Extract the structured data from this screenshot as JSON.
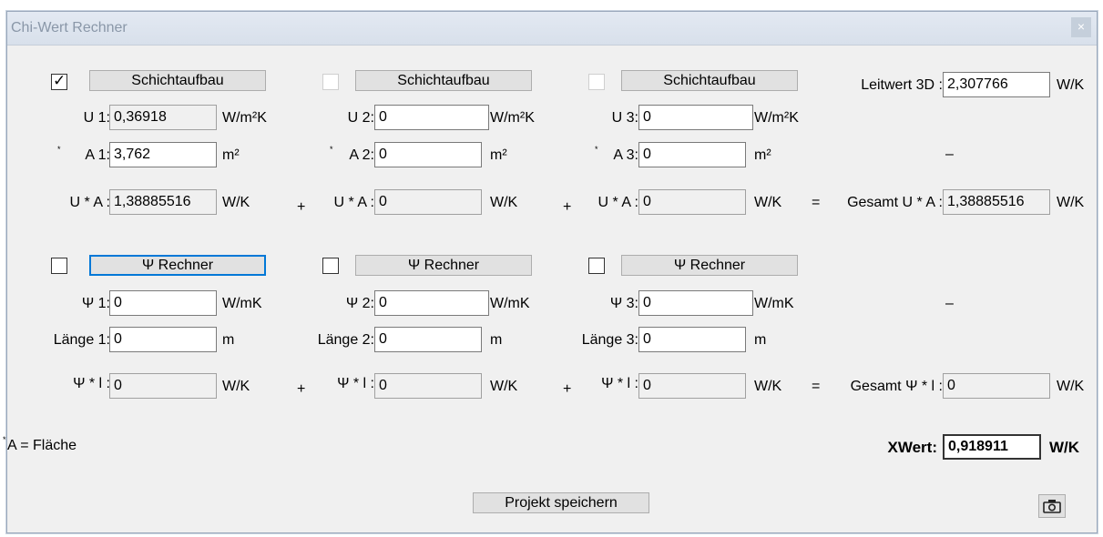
{
  "window": {
    "title": "Chi-Wert Rechner",
    "close_glyph": "×"
  },
  "layers": [
    {
      "checked": true,
      "button": "Schichtaufbau",
      "u_label": "U 1:",
      "u_value": "0,36918",
      "u_unit": "W/m²K",
      "a_label": "A 1:",
      "a_value": "3,762",
      "a_unit": "m²",
      "ua_label": "U * A :",
      "ua_value": "1,38885516",
      "ua_unit": "W/K"
    },
    {
      "checked": false,
      "button": "Schichtaufbau",
      "u_label": "U 2:",
      "u_value": "0",
      "u_unit": "W/m²K",
      "a_label": "A 2:",
      "a_value": "0",
      "a_unit": "m²",
      "ua_label": "U * A :",
      "ua_value": "0",
      "ua_unit": "W/K"
    },
    {
      "checked": false,
      "button": "Schichtaufbau",
      "u_label": "U 3:",
      "u_value": "0",
      "u_unit": "W/m²K",
      "a_label": "A 3:",
      "a_value": "0",
      "a_unit": "m²",
      "ua_label": "U * A :",
      "ua_value": "0",
      "ua_unit": "W/K"
    }
  ],
  "psi": [
    {
      "checked": false,
      "button": "Ψ Rechner",
      "psi_label": "Ψ 1:",
      "psi_value": "0",
      "psi_unit": "W/mK",
      "len_label": "Länge 1:",
      "len_value": "0",
      "len_unit": "m",
      "pl_label": "Ψ * l :",
      "pl_value": "0",
      "pl_unit": "W/K"
    },
    {
      "checked": false,
      "button": "Ψ Rechner",
      "psi_label": "Ψ 2:",
      "psi_value": "0",
      "psi_unit": "W/mK",
      "len_label": "Länge 2:",
      "len_value": "0",
      "len_unit": "m",
      "pl_label": "Ψ * l :",
      "pl_value": "0",
      "pl_unit": "W/K"
    },
    {
      "checked": false,
      "button": "Ψ Rechner",
      "psi_label": "Ψ 3:",
      "psi_value": "0",
      "psi_unit": "W/mK",
      "len_label": "Länge 3:",
      "len_value": "0",
      "len_unit": "m",
      "pl_label": "Ψ * l :",
      "pl_value": "0",
      "pl_unit": "W/K"
    }
  ],
  "right": {
    "leitwert_label": "Leitwert 3D :",
    "leitwert_value": "2,307766",
    "leitwert_unit": "W/K",
    "minus": "–",
    "gesamt_ua_label": "Gesamt U * A :",
    "gesamt_ua_value": "1,38885516",
    "gesamt_ua_unit": "W/K",
    "gesamt_pl_label": "Gesamt Ψ * l :",
    "gesamt_pl_value": "0",
    "gesamt_pl_unit": "W/K",
    "xwert_label": "XWert:",
    "xwert_value": "0,918911",
    "xwert_unit": "W/K"
  },
  "ops": {
    "plus": "+",
    "equals": "="
  },
  "footnote": {
    "star": "*",
    "text": "A = Fläche"
  },
  "footer": {
    "save_label": "Projekt speichern",
    "camera_icon": "camera-icon"
  }
}
